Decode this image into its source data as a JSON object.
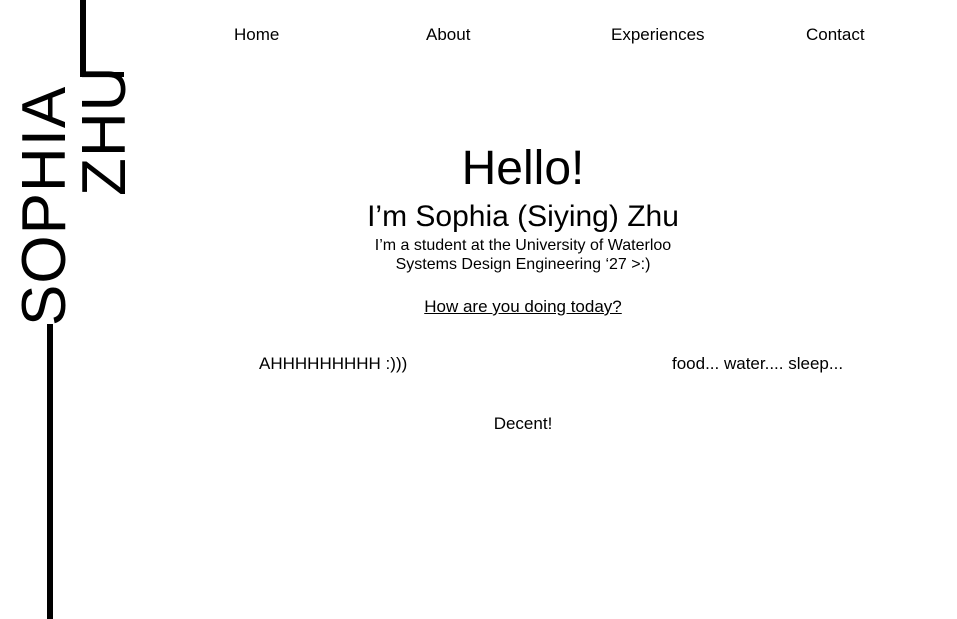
{
  "side_name": {
    "first": "SOPHIA",
    "last": "ZHU"
  },
  "nav": {
    "home": "Home",
    "about": "About",
    "experiences": "Experiences",
    "contact": "Contact"
  },
  "hero": {
    "greeting": "Hello!",
    "intro": "I’m Sophia (Siying) Zhu",
    "line1": "I’m a student at the University of Waterloo",
    "line2": "Systems Design Engineering ‘27 >:)",
    "question": "How are you doing today?"
  },
  "answers": [
    "AHHHHHHHHH :)))",
    "food... water.... sleep...",
    "Decent!"
  ],
  "colors": {
    "background": "#ffffff",
    "text": "#000000"
  }
}
